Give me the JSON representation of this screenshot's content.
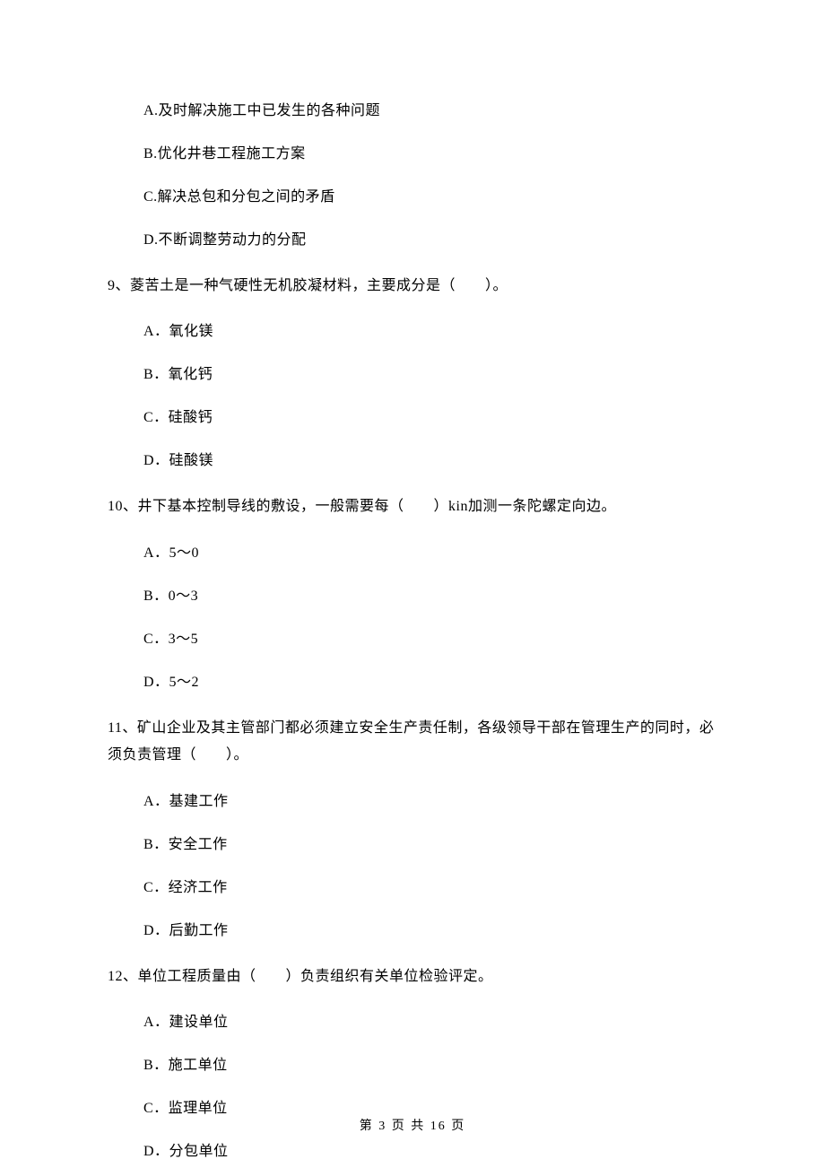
{
  "q8_options": {
    "a": "A.及时解决施工中已发生的各种问题",
    "b": "B.优化井巷工程施工方案",
    "c": "C.解决总包和分包之间的矛盾",
    "d": "D.不断调整劳动力的分配"
  },
  "q9": {
    "text": "9、菱苦土是一种气硬性无机胶凝材料，主要成分是（　　）。",
    "a": "A．氧化镁",
    "b": "B．氧化钙",
    "c": "C．硅酸钙",
    "d": "D．硅酸镁"
  },
  "q10": {
    "text": "10、井下基本控制导线的敷设，一般需要每（　　）kin加测一条陀螺定向边。",
    "a": "A．5～0",
    "b": "B．0～3",
    "c": "C．3～5",
    "d": "D．5～2"
  },
  "q11": {
    "text": "11、矿山企业及其主管部门都必须建立安全生产责任制，各级领导干部在管理生产的同时，必须负责管理（　　）。",
    "a": "A．基建工作",
    "b": "B．安全工作",
    "c": "C．经济工作",
    "d": "D．后勤工作"
  },
  "q12": {
    "text": "12、单位工程质量由（　　）负责组织有关单位检验评定。",
    "a": "A．建设单位",
    "b": "B．施工单位",
    "c": "C．监理单位",
    "d": "D．分包单位"
  },
  "footer": "第 3 页 共 16 页"
}
